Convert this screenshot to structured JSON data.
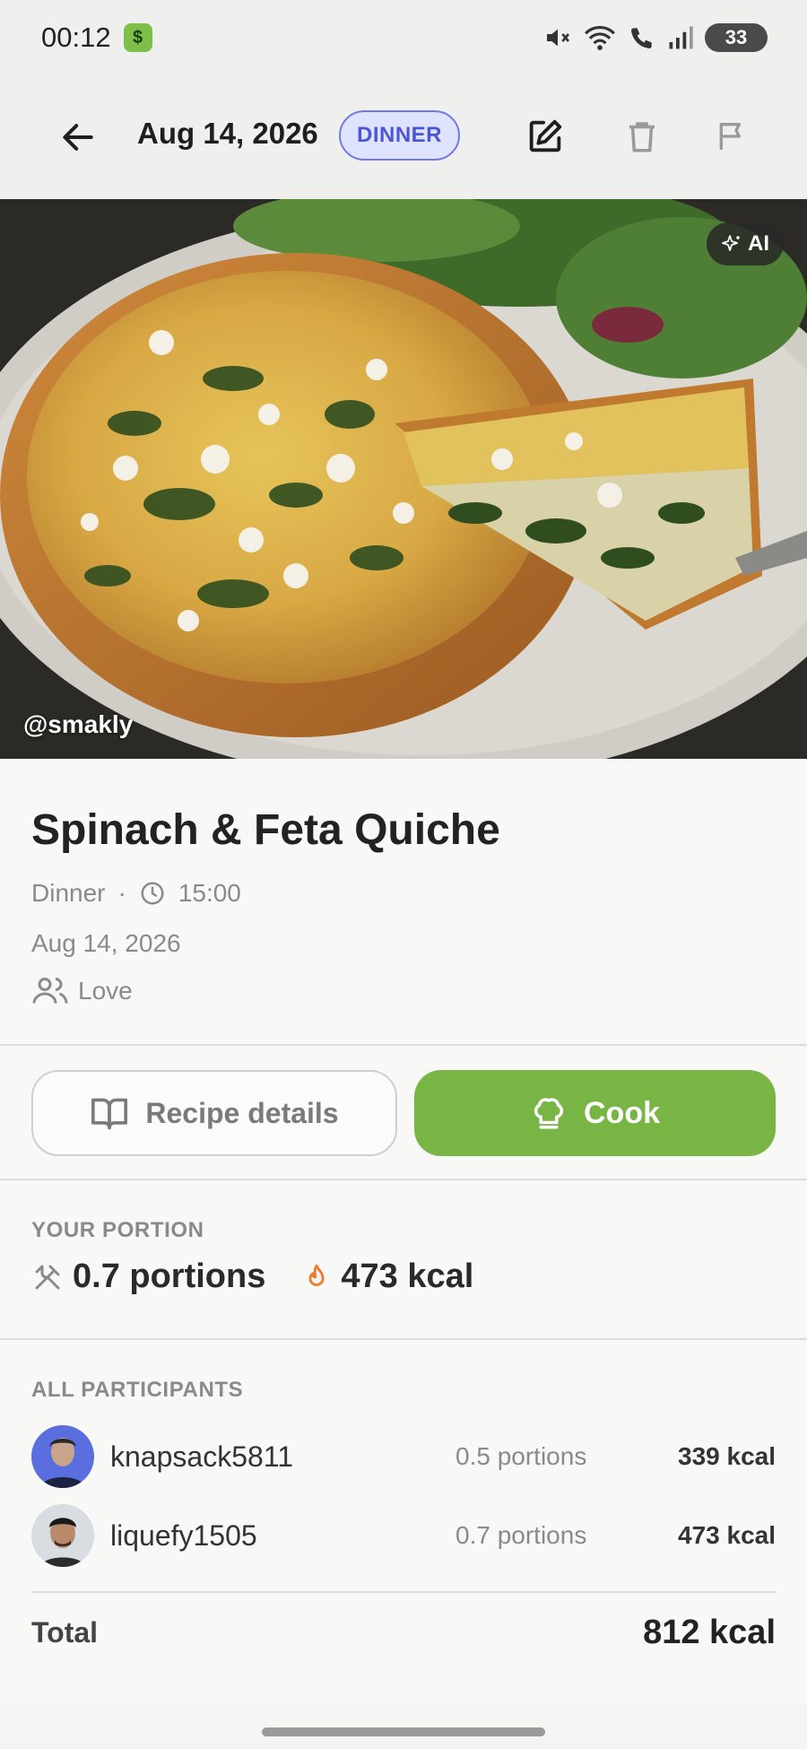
{
  "status_bar": {
    "time": "00:12",
    "app_badge": "$",
    "battery": "33"
  },
  "app_bar": {
    "date": "Aug 14, 2026",
    "meal_chip": "DINNER"
  },
  "hero": {
    "ai_badge": "AI",
    "credit": "@smakly"
  },
  "meal": {
    "title": "Spinach & Feta Quiche",
    "type": "Dinner",
    "separator": "·",
    "time": "15:00",
    "date": "Aug 14, 2026",
    "group": "Love"
  },
  "actions": {
    "recipe_label": "Recipe details",
    "cook_label": "Cook",
    "cook_color": "#78b544"
  },
  "your_portion": {
    "label": "YOUR PORTION",
    "portions": "0.7 portions",
    "kcal": "473 kcal"
  },
  "participants": {
    "label": "ALL PARTICIPANTS",
    "rows": [
      {
        "name": "knapsack5811",
        "portions": "0.5 portions",
        "kcal": "339 kcal"
      },
      {
        "name": "liquefy1505",
        "portions": "0.7 portions",
        "kcal": "473 kcal"
      }
    ],
    "total_label": "Total",
    "total_value": "812 kcal"
  }
}
